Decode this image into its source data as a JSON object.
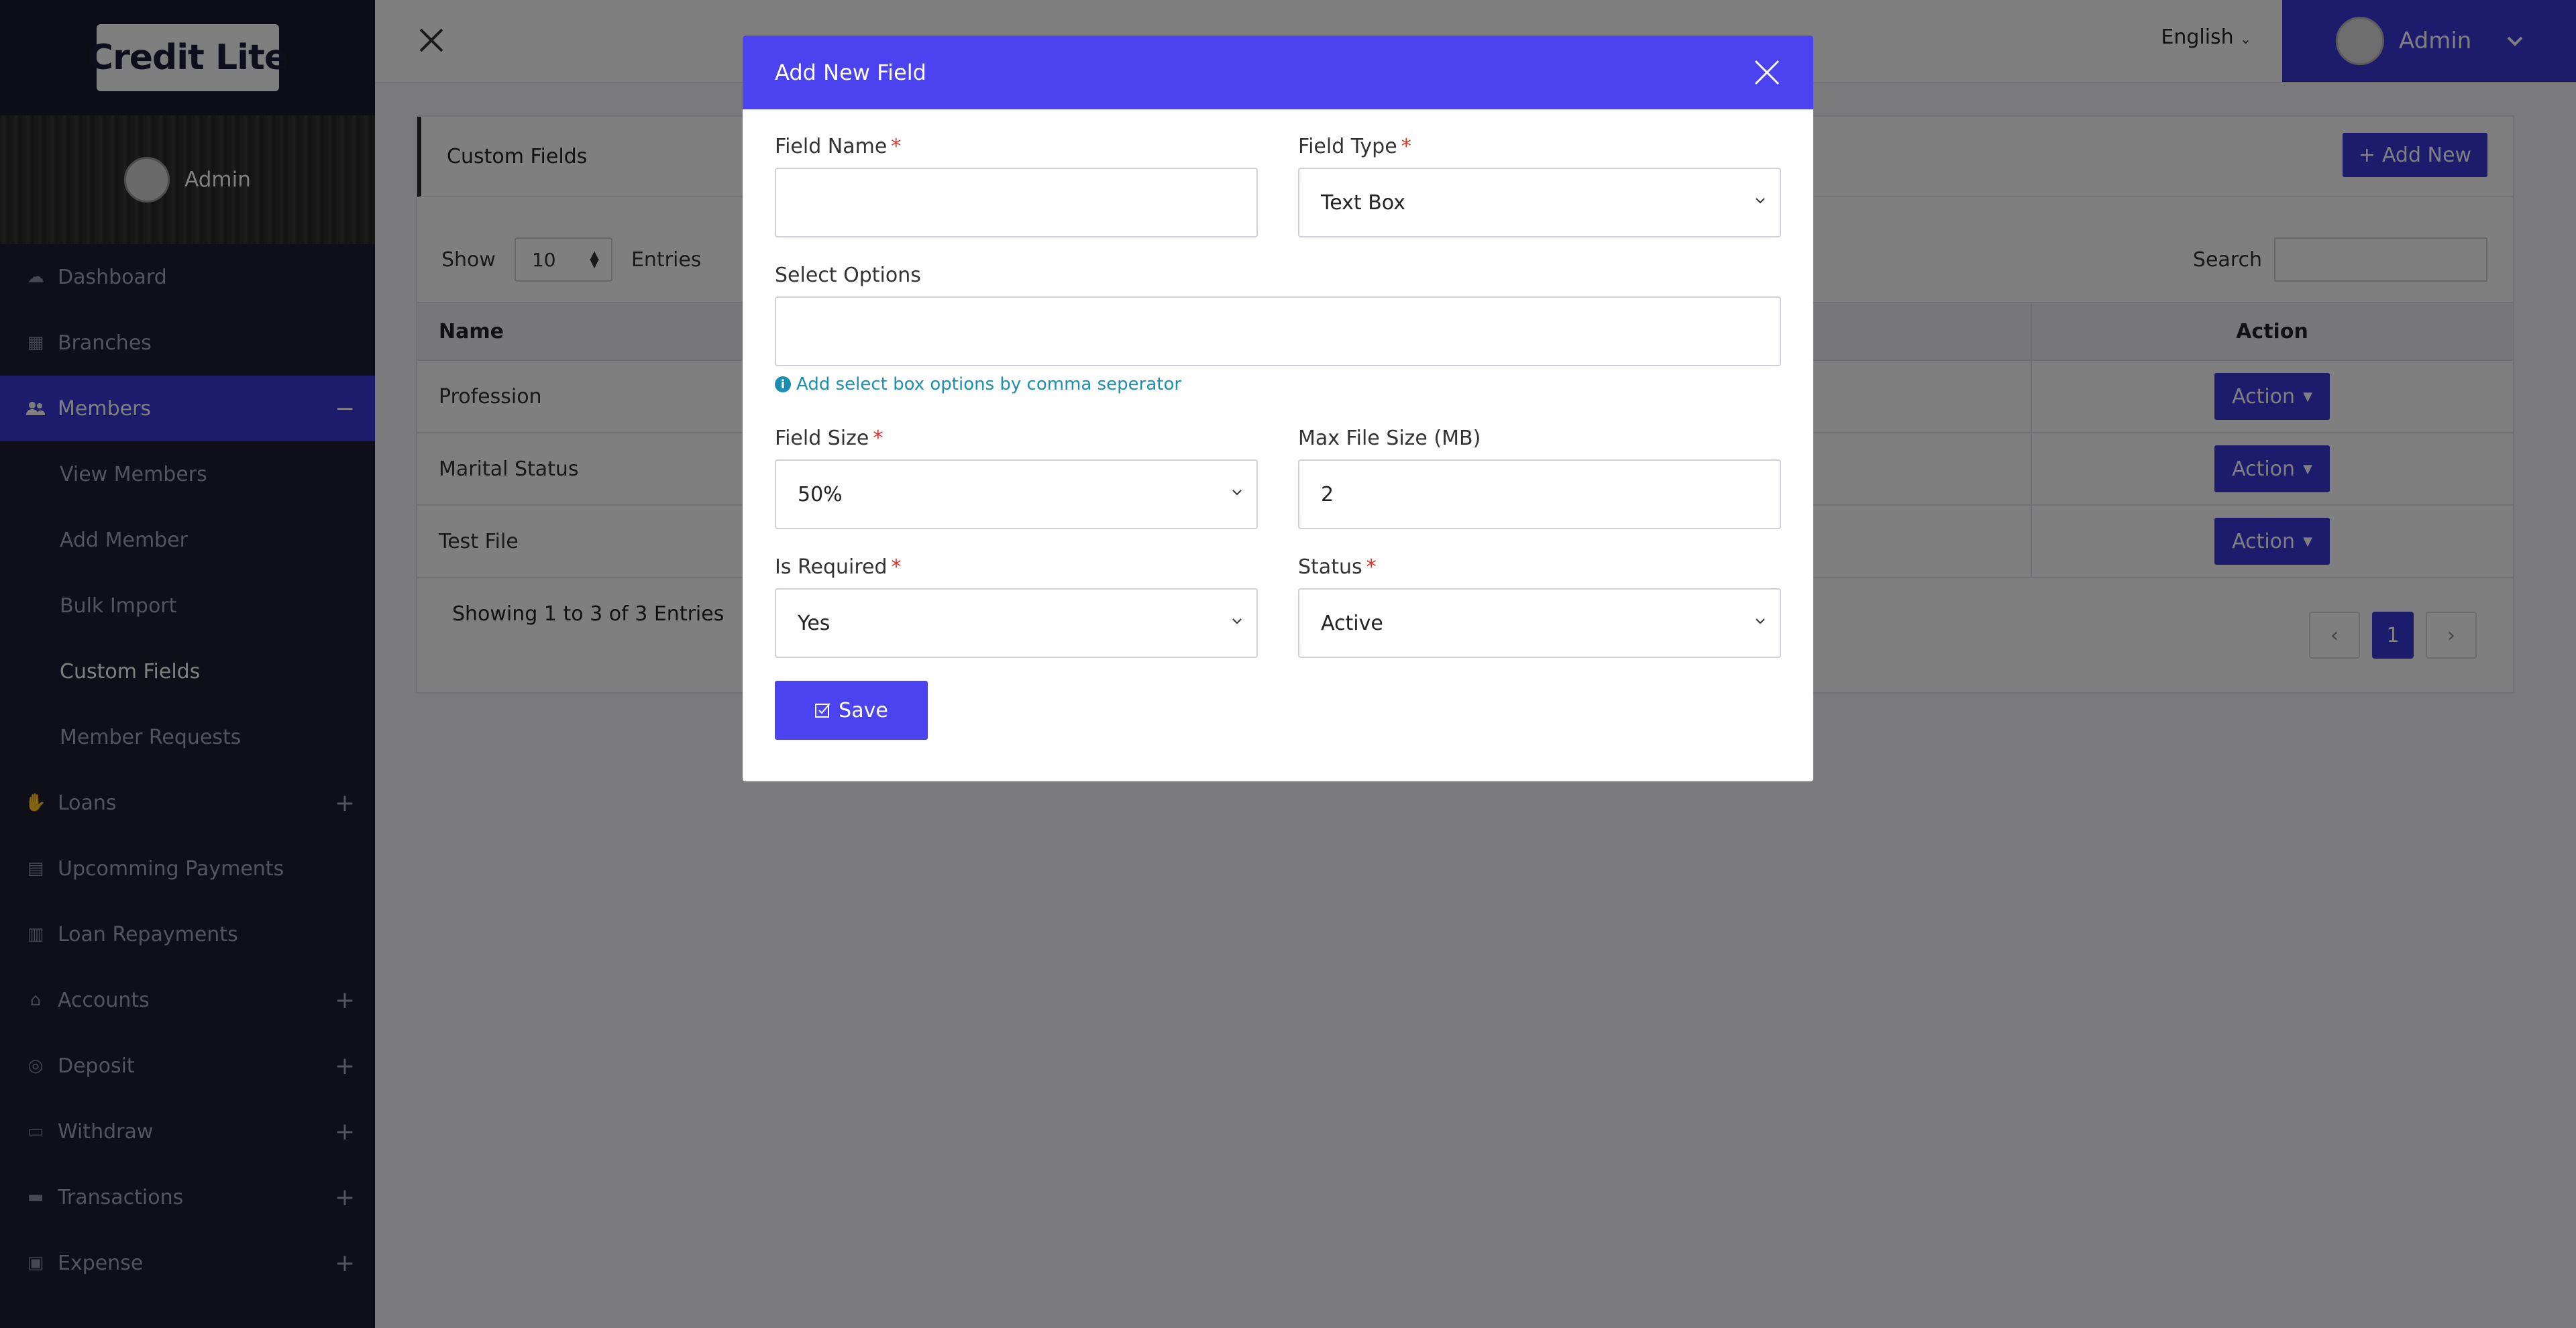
{
  "brand": {
    "name_part1": "Credit",
    "name_part2": "Lite"
  },
  "sidebar": {
    "user_name": "Admin",
    "items": [
      {
        "label": "Dashboard",
        "icon": "dashboard-icon",
        "glyph": "☁"
      },
      {
        "label": "Branches",
        "icon": "building-icon",
        "glyph": "▦"
      },
      {
        "label": "Members",
        "icon": "users-icon",
        "glyph": "👥"
      },
      {
        "label": "Loans",
        "icon": "hand-coin-icon",
        "glyph": "✋"
      },
      {
        "label": "Upcomming Payments",
        "icon": "calendar-icon",
        "glyph": "▤"
      },
      {
        "label": "Loan Repayments",
        "icon": "receipt-icon",
        "glyph": "▥"
      },
      {
        "label": "Accounts",
        "icon": "bank-icon",
        "glyph": "⌂"
      },
      {
        "label": "Deposit",
        "icon": "coins-icon",
        "glyph": "◎"
      },
      {
        "label": "Withdraw",
        "icon": "credit-card-icon",
        "glyph": "▭"
      },
      {
        "label": "Transactions",
        "icon": "wallet-icon",
        "glyph": "▬"
      },
      {
        "label": "Expense",
        "icon": "money-icon",
        "glyph": "▣"
      }
    ],
    "members_sub": [
      "View Members",
      "Add Member",
      "Bulk Import",
      "Custom Fields",
      "Member Requests"
    ],
    "collapse_symbol": "−",
    "expand_symbol": "+"
  },
  "topbar": {
    "language": "English",
    "admin_name": "Admin"
  },
  "card": {
    "title": "Custom Fields",
    "add_new_label": "Add New",
    "show_label": "Show",
    "entries_label": "Entries",
    "page_length": "10",
    "search_label": "Search",
    "columns": [
      "Name",
      "Action"
    ],
    "rows": [
      "Profession",
      "Marital Status",
      "Test File"
    ],
    "action_label": "Action",
    "showing_text": "Showing 1 to 3 of 3 Entries",
    "current_page": "1"
  },
  "modal": {
    "title": "Add New Field",
    "field_name_label": "Field Name",
    "field_name_value": "",
    "field_type_label": "Field Type",
    "field_type_value": "Text Box",
    "select_options_label": "Select Options",
    "select_options_value": "",
    "select_options_hint": "Add select box options by comma seperator",
    "field_size_label": "Field Size",
    "field_size_value": "50%",
    "max_file_size_label": "Max File Size (MB)",
    "max_file_size_value": "2",
    "is_required_label": "Is Required",
    "is_required_value": "Yes",
    "status_label": "Status",
    "status_value": "Active",
    "save_label": "Save",
    "required_mark": "*"
  },
  "colors": {
    "primary": "#3b36d9",
    "modal_header": "#4a43ef",
    "sidebar_bg": "#1f1f35",
    "required": "#e0312c",
    "hint": "#1c8fb0"
  }
}
